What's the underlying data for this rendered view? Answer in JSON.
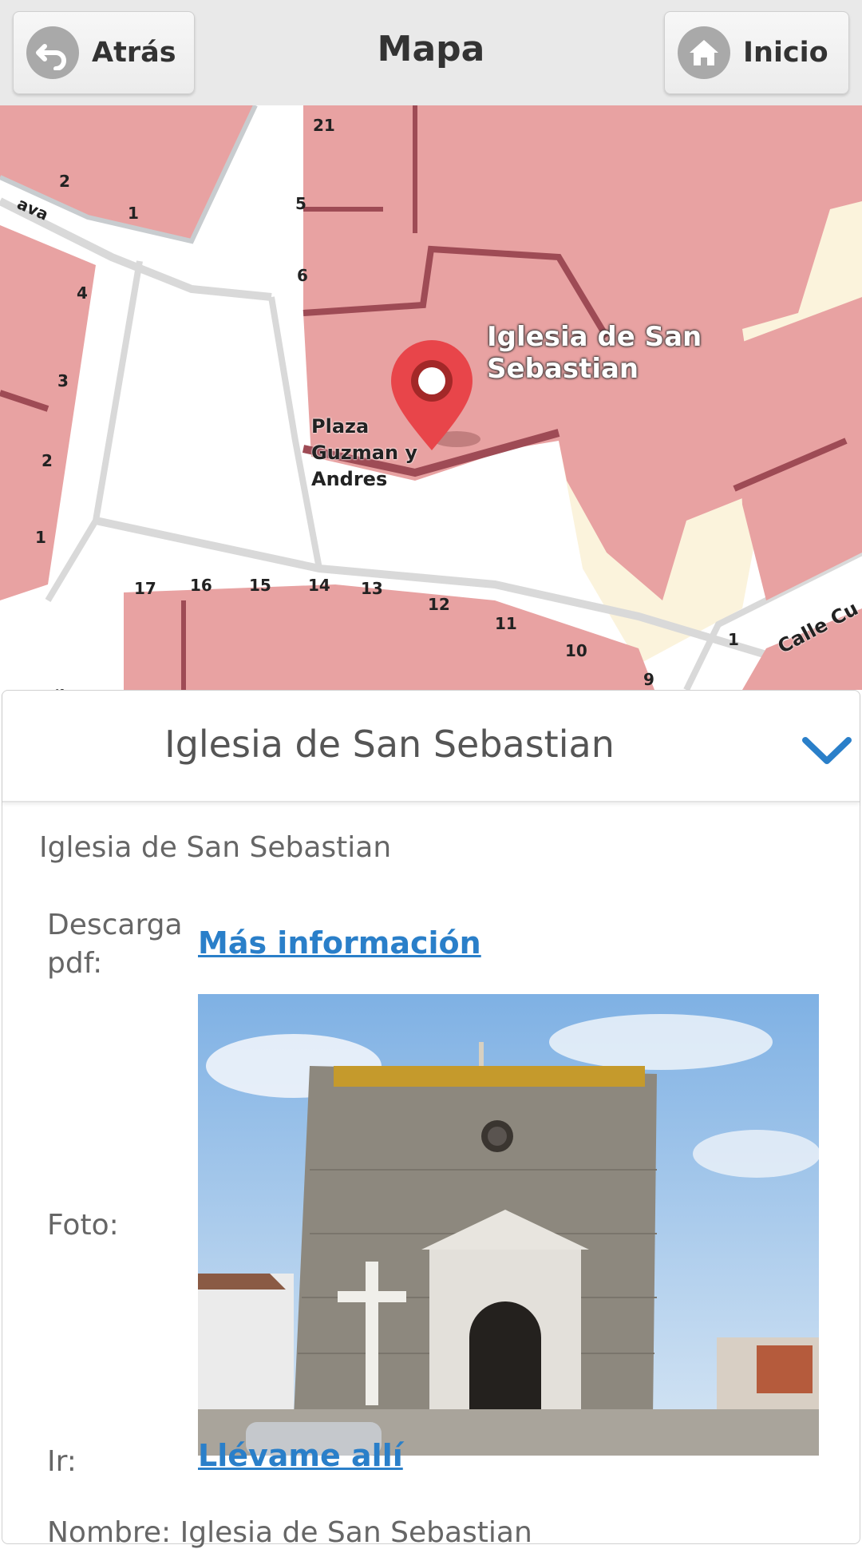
{
  "header": {
    "back_label": "Atrás",
    "title": "Mapa",
    "home_label": "Inicio"
  },
  "map": {
    "poi_label": "Iglesia de San Sebastian",
    "plaza_label": [
      "Plaza",
      "Guzman y",
      "Andres"
    ],
    "street_label": "Calle Cu",
    "street_label_left": "ava",
    "street_label_bottom": "somas",
    "house_numbers": [
      "21",
      "2",
      "1",
      "5",
      "6",
      "4",
      "3",
      "2",
      "1",
      "17",
      "16",
      "15",
      "14",
      "13",
      "12",
      "11",
      "10",
      "9",
      "1"
    ],
    "marker_color": "#e8454a",
    "building_color": "#e8a2a2",
    "plaza_color": "#ffffff"
  },
  "detail": {
    "title": "Iglesia de San Sebastian",
    "subtitle": "Iglesia de San Sebastian",
    "pdf_label": "Descarga pdf:",
    "pdf_link": "Más información",
    "photo_label": "Foto:",
    "go_label": "Ir:",
    "go_link": "Llévame allí",
    "cutoff_text": "Nombre: Iglesia de San Sebastian",
    "accent_color": "#2a7fc9"
  }
}
